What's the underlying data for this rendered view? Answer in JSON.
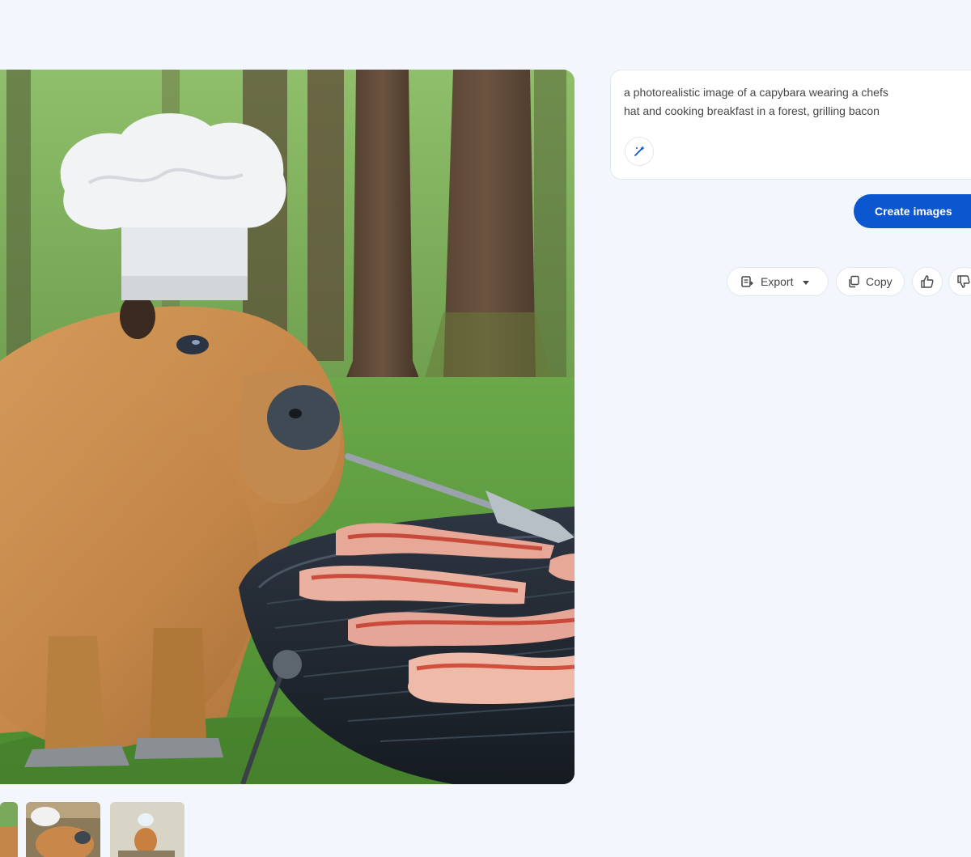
{
  "prompt": {
    "text_line1": "a photorealistic image of a capybara wearing a chefs",
    "text_line2": "hat and cooking breakfast in a forest, grilling bacon"
  },
  "prompt_actions": {
    "enhance_icon": "magic-wand-icon"
  },
  "create_button": {
    "label": "Create images"
  },
  "response_actions": {
    "export_label": "Export",
    "copy_label": "Copy",
    "export_icon": "sheets-export-icon",
    "copy_icon": "copy-icon",
    "like_icon": "thumb-up-icon",
    "dislike_icon": "thumb-down-icon"
  },
  "colors": {
    "accent": "#0b57d0",
    "background": "#f3f6fc",
    "card": "#ffffff"
  }
}
